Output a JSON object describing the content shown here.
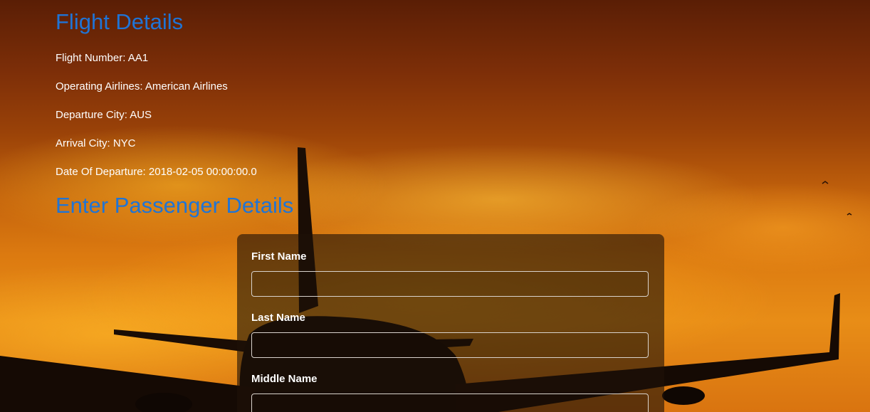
{
  "flight_details": {
    "title": "Flight Details",
    "flight_number": "Flight Number: AA1",
    "operating_airlines": "Operating Airlines: American Airlines",
    "departure_city": "Departure City: AUS",
    "arrival_city": "Arrival City: NYC",
    "date_of_departure": "Date Of Departure: 2018-02-05 00:00:00.0"
  },
  "passenger_details": {
    "title": "Enter Passenger Details",
    "fields": [
      {
        "label": "First Name",
        "value": ""
      },
      {
        "label": "Last Name",
        "value": ""
      },
      {
        "label": "Middle Name",
        "value": ""
      }
    ]
  },
  "colors": {
    "heading": "#1f74d6",
    "text": "#ffffff",
    "panel": "rgba(30,18,8,0.62)"
  }
}
